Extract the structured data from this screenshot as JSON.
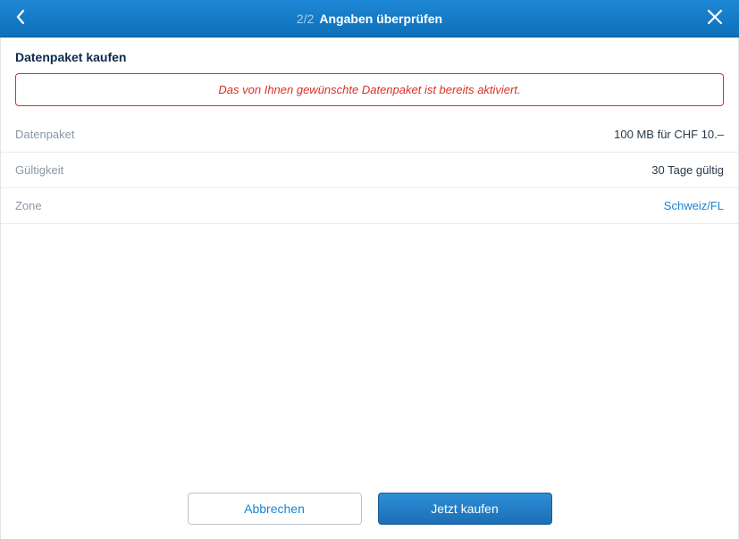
{
  "header": {
    "step": "2/2",
    "title": "Angaben überprüfen"
  },
  "section_title": "Datenpaket kaufen",
  "alert": "Das von Ihnen gewünschte Datenpaket ist bereits aktiviert.",
  "rows": {
    "datapacket": {
      "label": "Datenpaket",
      "value": "100 MB für CHF 10.–"
    },
    "validity": {
      "label": "Gültigkeit",
      "value": "30 Tage gültig"
    },
    "zone": {
      "label": "Zone",
      "value": "Schweiz/FL"
    }
  },
  "footer": {
    "cancel": "Abbrechen",
    "buy": "Jetzt kaufen"
  }
}
